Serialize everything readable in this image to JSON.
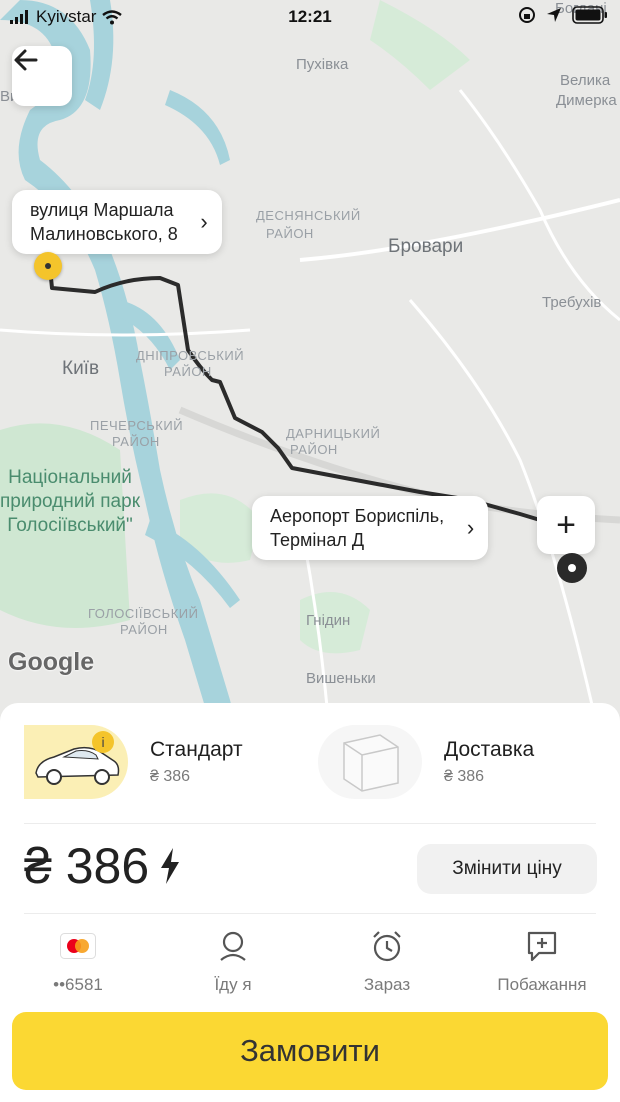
{
  "status_bar": {
    "carrier": "Kyivstar",
    "time": "12:21"
  },
  "map": {
    "labels": {
      "puhivka": "Пухівка",
      "velyka_dymerka_1": "Велика",
      "velyka_dymerka_2": "Димерка",
      "bohdanivka": "Богдані",
      "desnianskyi_1": "ДЕСНЯНСЬКИЙ",
      "desnianskyi_2": "РАЙОН",
      "brovary": "Бровари",
      "trebukhiv": "Требухів",
      "dniprovskyi_1": "ДНІПРОВСЬКИЙ",
      "dniprovskyi_2": "РАЙОН",
      "kyiv": "Київ",
      "pecherskyi_1": "ПЕЧЕРСЬКИЙ",
      "pecherskyi_2": "РАЙОН",
      "darnytskyi_1": "ДАРНИЦЬКИЙ",
      "darnytskyi_2": "РАЙОН",
      "park": "Національний природний парк Голосіївський\"",
      "holosiivskyi_1": "ГОЛОСІЇВСЬКИЙ",
      "holosiivskyi_2": "РАЙОН",
      "hnidyn": "Гнідин",
      "vyshenky": "Вишеньки",
      "vy": "Ви"
    },
    "google_logo": "Google",
    "origin_bubble": {
      "line1": "вулиця Маршала",
      "line2": "Малиновського, 8"
    },
    "destination_bubble": {
      "line1": "Аеропорт Бориспіль,",
      "line2": "Термінал Д"
    },
    "route_color": "#2b2b2b"
  },
  "tariffs": [
    {
      "name": "Стандарт",
      "price": "₴ 386",
      "selected": true
    },
    {
      "name": "Доставка",
      "price": "₴ 386",
      "selected": false
    }
  ],
  "price": {
    "amount": "₴ 386",
    "change_label": "Змінити ціну"
  },
  "options": [
    {
      "label": "••6581",
      "icon": "mastercard-icon"
    },
    {
      "label": "Їду я",
      "icon": "person-icon"
    },
    {
      "label": "Зараз",
      "icon": "alarm-clock-icon"
    },
    {
      "label": "Побажання",
      "icon": "comment-plus-icon"
    }
  ],
  "order_label": "Замовити",
  "colors": {
    "accent": "#fbd833",
    "water": "#a7d3dc",
    "park": "#c9e5cf"
  }
}
